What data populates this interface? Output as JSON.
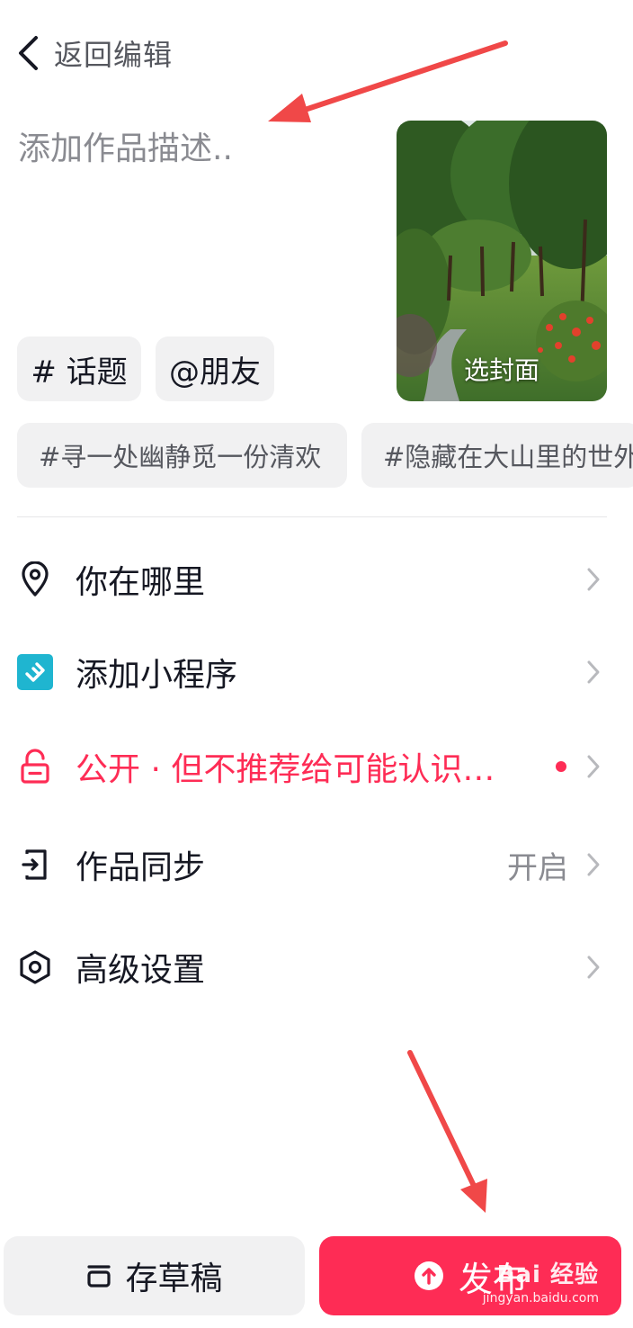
{
  "header": {
    "back_label": "返回编辑"
  },
  "description": {
    "placeholder": "添加作品描述.."
  },
  "cover": {
    "label": "选封面"
  },
  "chips": {
    "topic": "# 话题",
    "friend": "@朋友"
  },
  "suggestions": [
    "#寻一处幽静觅一份清欢",
    "#隐藏在大山里的世外"
  ],
  "rows": [
    {
      "label": "你在哪里",
      "value": ""
    },
    {
      "label": "添加小程序",
      "value": ""
    },
    {
      "label": "公开 · 但不推荐给可能认识…",
      "value": ""
    },
    {
      "label": "作品同步",
      "value": "开启"
    },
    {
      "label": "高级设置",
      "value": ""
    }
  ],
  "footer": {
    "draft_label": "存草稿",
    "publish_label": "发布"
  },
  "watermark": {
    "text": "Bai 经验",
    "url": "jingyan.baidu.com"
  },
  "colors": {
    "accent": "#fe2c55",
    "miniapp": "#1fb5d0",
    "annotation_arrow": "#f04848"
  }
}
